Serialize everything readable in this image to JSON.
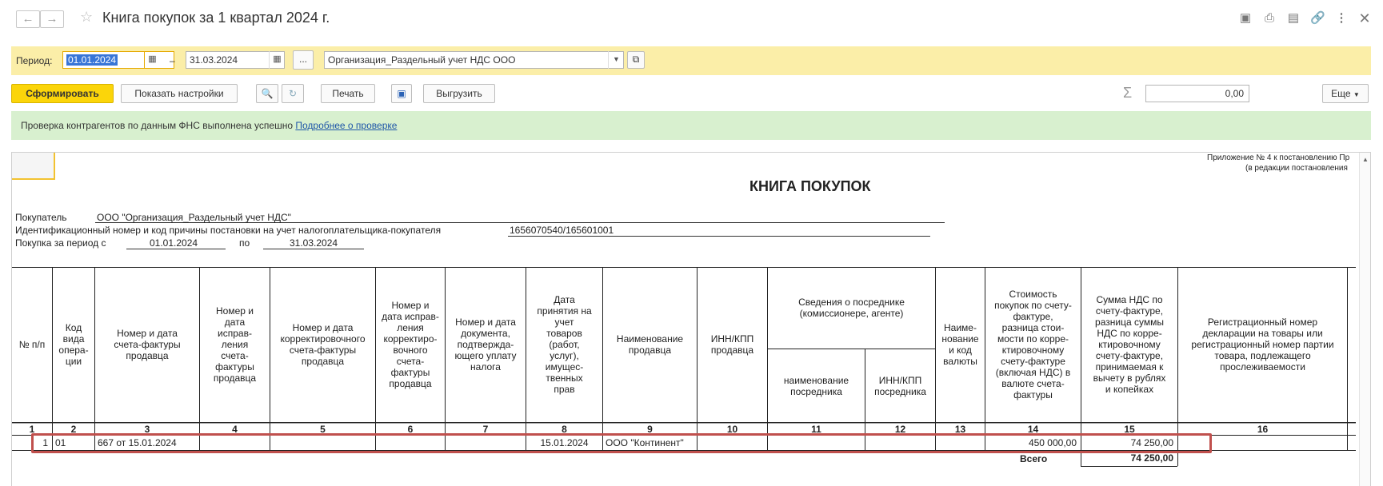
{
  "window": {
    "title": "Книга покупок за 1 квартал 2024 г.",
    "icons": [
      "back-arrow-icon",
      "forward-arrow-icon",
      "star-icon",
      "save-icon",
      "print-icon",
      "preview-icon",
      "link-icon",
      "more-vertical-icon",
      "close-icon"
    ]
  },
  "period": {
    "label": "Период:",
    "from": "01.01.2024",
    "dash": "–",
    "to": "31.03.2024",
    "ellipsis": "...",
    "organization": "Организация_Раздельный учет НДС ООО"
  },
  "toolbar": {
    "generate": "Сформировать",
    "show_settings": "Показать настройки",
    "print": "Печать",
    "export": "Выгрузить",
    "sigma": "Σ",
    "sum_value": "0,00",
    "more": "Еще"
  },
  "info": {
    "text": "Проверка контрагентов по данным ФНС выполнена успешно",
    "link": "Подробнее о проверке"
  },
  "report": {
    "appendix_line1": "Приложение № 4 к постановлению Пр",
    "appendix_line2": "(в редакции постановления",
    "title": "КНИГА ПОКУПОК",
    "buyer_label": "Покупатель",
    "buyer_value": "ООО \"Организация_Раздельный учет НДС\"",
    "inn_label": "Идентификационный номер и код причины постановки на учет налогоплательщика-покупателя",
    "inn_value": "1656070540/165601001",
    "period_label": "Покупка за период с",
    "period_from": "01.01.2024",
    "period_by": "по",
    "period_to": "31.03.2024",
    "headers": {
      "c1": "№ п/п",
      "c2": "Код вида опера-ции",
      "c3": "Номер и дата счета-фактуры продавца",
      "c4": "Номер и дата исправ-ления счета-фактуры продавца",
      "c5": "Номер и дата корректировочного счета-фактуры продавца",
      "c6": "Номер и дата исправ-ления корректиро-вочного счета-фактуры продавца",
      "c7": "Номер и дата документа, подтвержда-ющего уплату налога",
      "c8": "Дата принятия на учет товаров (работ, услуг), имущес-твенных прав",
      "c9": "Наименование продавца",
      "c10": "ИНН/КПП продавца",
      "c11_group": "Сведения о посреднике (комиссионере, агенте)",
      "c11": "наименование посредника",
      "c12": "ИНН/КПП посредника",
      "c13": "Наиме-нование и код валюты",
      "c14": "Стоимость покупок по счету-фактуре, разница стои-мости по корре-ктировочному счету-фактуре (включая НДС) в валюте счета-фактуры",
      "c15": "Сумма НДС по счету-фактуре, разница суммы НДС по корре-ктировочному счету-фактуре, принимаемая к вычету в рублях и копейках",
      "c16": "Регистрационный номер декларации на товары или регистрационный номер партии товара, подлежащего прослеживаемости"
    },
    "col_numbers": [
      "1",
      "2",
      "3",
      "4",
      "5",
      "6",
      "7",
      "8",
      "9",
      "10",
      "11",
      "12",
      "13",
      "14",
      "15",
      "16"
    ],
    "rows": [
      {
        "n": "1",
        "code": "01",
        "invoice": "667 от 15.01.2024",
        "date": "15.01.2024",
        "seller": "ООО \"Континент\"",
        "cost": "450 000,00",
        "vat": "74 250,00"
      }
    ],
    "total_label": "Всего",
    "total_vat": "74 250,00"
  }
}
